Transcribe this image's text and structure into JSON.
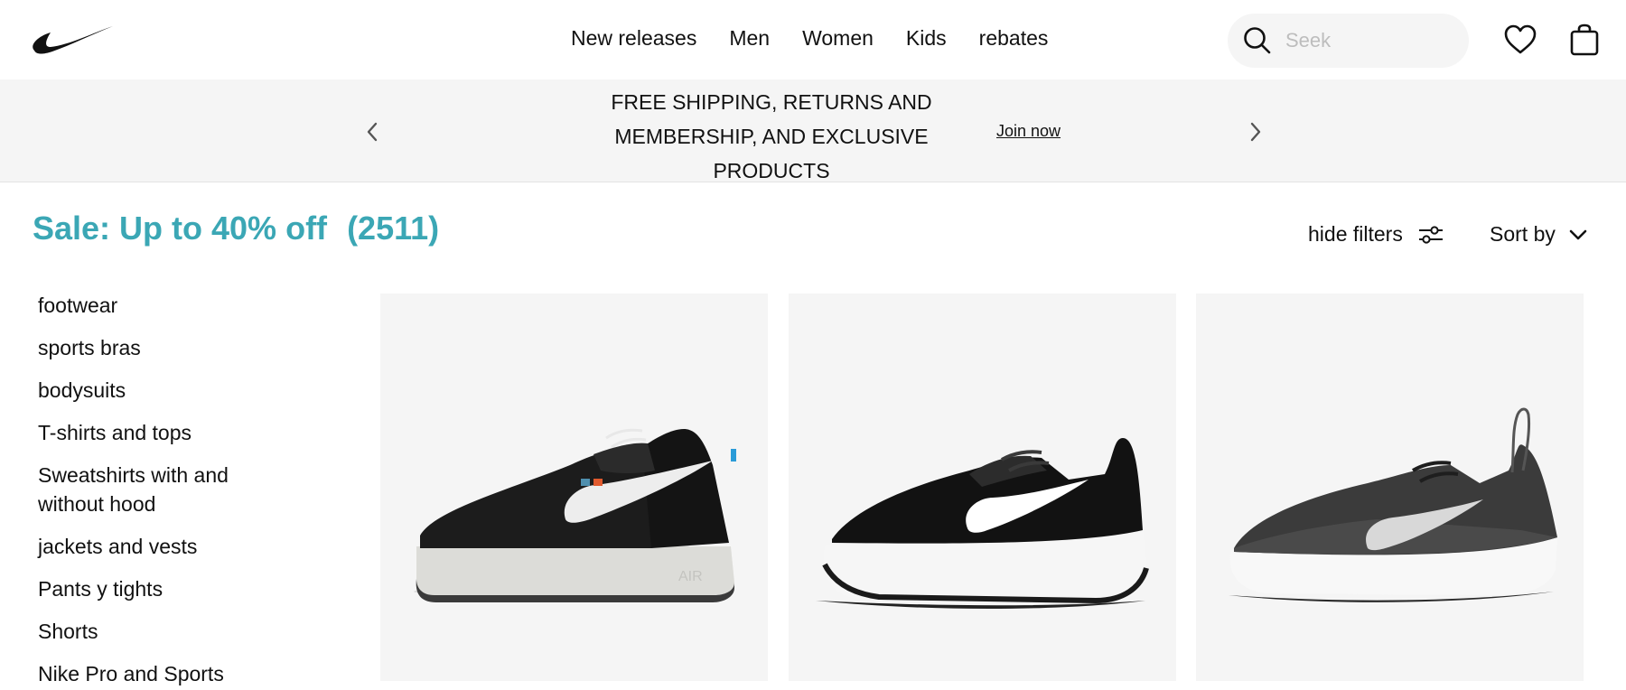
{
  "header": {
    "brand": "Nike",
    "nav": [
      "New releases",
      "Men",
      "Women",
      "Kids",
      "rebates"
    ],
    "search": {
      "placeholder": "Seek",
      "value": ""
    },
    "icons": [
      "nike-swoosh-logo",
      "search-icon",
      "heart-icon",
      "bag-icon"
    ]
  },
  "banner": {
    "lines": [
      "FREE SHIPPING, RETURNS AND",
      "MEMBERSHIP, AND EXCLUSIVE",
      "PRODUCTS"
    ],
    "link": "Join now",
    "icons": [
      "chevron-left-icon",
      "chevron-right-icon"
    ]
  },
  "title": {
    "text": "Sale: Up to 40% off",
    "count": "(2511)",
    "color": "#3ba7b5"
  },
  "controls": {
    "hide_filters": "hide filters",
    "sort_by": "Sort by",
    "icons": [
      "filter-sliders-icon",
      "chevron-down-icon"
    ]
  },
  "sidebar": {
    "items": [
      "footwear",
      "sports bras",
      "bodysuits",
      "T-shirts and tops",
      "Sweatshirts with and without hood",
      "jackets and vests",
      "Pants y tights",
      "Shorts",
      "Nike Pro and Sports"
    ]
  },
  "products": [
    {
      "image": "black-low-top-sneaker-white-swoosh"
    },
    {
      "image": "black-running-shoe-white-sole"
    },
    {
      "image": "dark-grey-knit-running-shoe"
    }
  ],
  "colors": {
    "accent": "#3ba7b5",
    "text": "#111111",
    "panel": "#f5f5f5"
  }
}
